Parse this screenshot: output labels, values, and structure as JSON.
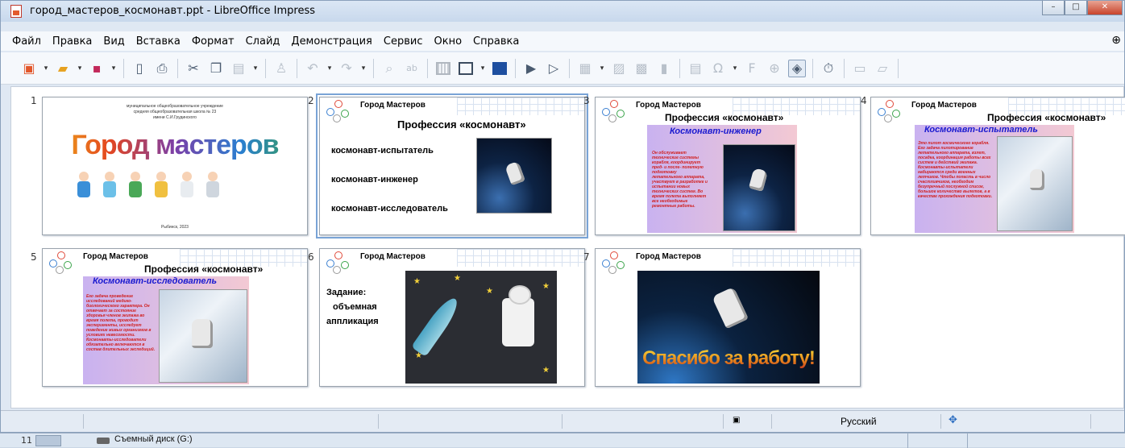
{
  "window": {
    "title": "город_мастеров_космонавт.ppt - LibreOffice Impress"
  },
  "menu": [
    "Файл",
    "Правка",
    "Вид",
    "Вставка",
    "Формат",
    "Слайд",
    "Демонстрация",
    "Сервис",
    "Окно",
    "Справка"
  ],
  "slides": [
    {
      "number": "1",
      "org_lines": [
        "муниципальное общеобразовательное учреждение",
        "средняя общеобразовательная школа № 23",
        "имени С.И.Грудинского"
      ],
      "big_title": "Город мастеров",
      "footer": "Рыбинск, 2023"
    },
    {
      "number": "2",
      "header": "Город Мастеров",
      "title": "Профессия «космонавт»",
      "items": [
        "космонавт-испытатель",
        "космонавт-инженер",
        "космонавт-исследователь"
      ]
    },
    {
      "number": "3",
      "header": "Город Мастеров",
      "title": "Профессия «космонавт»",
      "subtitle": "Космонавт-инженер",
      "body": "Он обслуживает технические системы корабля, координирует пред- и после- полетную подготовку летательного аппарата, участвует в разработке и испытании новых технических систем. Во время полета выполняет все необходимые ремонтные работы."
    },
    {
      "number": "4",
      "header": "Город Мастеров",
      "title": "Профессия «космонавт»",
      "subtitle": "Космонавт-испытатель",
      "body": "Это пилот космического корабля. Его задача пилотирование летательного аппарата, взлет, посадка, координация работы всех систем и действий экипажа. Космонавты-испытатели набираются среди военных летчиков. Чтобы попасть в число счастливчиков, необходим безупречный послужной список, большое количество вылетов, а в качестве прохождения подготовки."
    },
    {
      "number": "5",
      "header": "Город Мастеров",
      "title": "Профессия «космонавт»",
      "subtitle": "Космонавт-исследователь",
      "body": "Его задача проведение исследований медико-биологического характера. Он отвечает за состояние здоровья членов экипажа во время полета, проводит эксперименты, исследует поведение живых организмов в условиях невесомости. Космонавты-исследователи обязательно включаются в состав длительных экспедиций."
    },
    {
      "number": "6",
      "header": "Город Мастеров",
      "task_lines": [
        "Задание:",
        "объемная",
        "аппликация"
      ]
    },
    {
      "number": "7",
      "header": "Город Мастеров",
      "thanks": "Спасибо за работу!"
    }
  ],
  "status": {
    "language": "Русский"
  },
  "taskbar": {
    "index": "11",
    "drive": "Съемный диск (G:)"
  }
}
